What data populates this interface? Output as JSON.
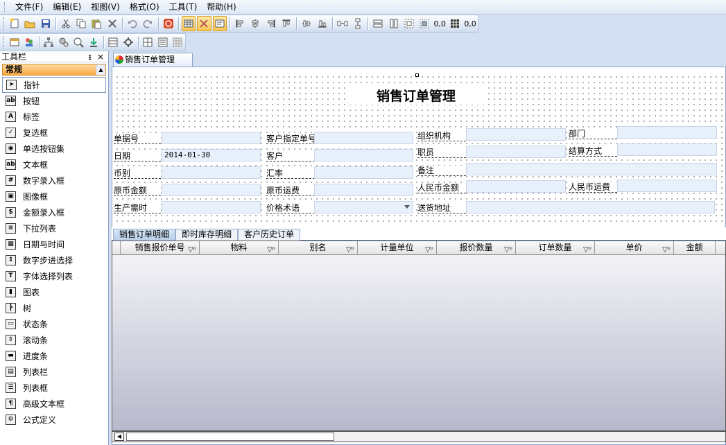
{
  "menu": [
    "文件(F)",
    "编辑(E)",
    "视图(V)",
    "格式(O)",
    "工具(T)",
    "帮助(H)"
  ],
  "toolbar": {
    "spacing_value_1": "0,0",
    "spacing_value_2": "0,0"
  },
  "toolbox": {
    "title": "工具栏",
    "pin": "ᵻ",
    "close": "×",
    "category": "常规",
    "items": [
      {
        "label": "指针",
        "icon": "pointer-icon",
        "glyph": "➤"
      },
      {
        "label": "按钮",
        "icon": "button-icon",
        "glyph": "ab"
      },
      {
        "label": "标签",
        "icon": "label-icon",
        "glyph": "A"
      },
      {
        "label": "复选框",
        "icon": "checkbox-icon",
        "glyph": "✓"
      },
      {
        "label": "单选按钮集",
        "icon": "radio-icon",
        "glyph": "◉"
      },
      {
        "label": "文本框",
        "icon": "textbox-icon",
        "glyph": "ab"
      },
      {
        "label": "数字录入框",
        "icon": "number-input-icon",
        "glyph": "#"
      },
      {
        "label": "图像框",
        "icon": "image-icon",
        "glyph": "▣"
      },
      {
        "label": "金额录入框",
        "icon": "currency-input-icon",
        "glyph": "$"
      },
      {
        "label": "下拉列表",
        "icon": "dropdown-icon",
        "glyph": "≡"
      },
      {
        "label": "日期与时间",
        "icon": "calendar-icon",
        "glyph": "▦"
      },
      {
        "label": "数字步进选择",
        "icon": "stepper-icon",
        "glyph": "⇕"
      },
      {
        "label": "字体选择列表",
        "icon": "font-icon",
        "glyph": "T"
      },
      {
        "label": "图表",
        "icon": "chart-icon",
        "glyph": "▮"
      },
      {
        "label": "树",
        "icon": "tree-icon",
        "glyph": "┣"
      },
      {
        "label": "状态条",
        "icon": "statusbar-icon",
        "glyph": "▭"
      },
      {
        "label": "滚动条",
        "icon": "scrollbar-icon",
        "glyph": "⇳"
      },
      {
        "label": "进度条",
        "icon": "progressbar-icon",
        "glyph": "▬"
      },
      {
        "label": "列表栏",
        "icon": "listbar-icon",
        "glyph": "▤"
      },
      {
        "label": "列表框",
        "icon": "listbox-icon",
        "glyph": "☰"
      },
      {
        "label": "高级文本框",
        "icon": "richtext-icon",
        "glyph": "¶"
      },
      {
        "label": "公式定义",
        "icon": "formula-icon",
        "glyph": "⚙"
      }
    ]
  },
  "document": {
    "tab": "销售订单管理",
    "form_title": "销售订单管理",
    "fields": {
      "bill_no": {
        "label": "单据号",
        "value": ""
      },
      "cust_order_no": {
        "label": "客户指定单号",
        "value": ""
      },
      "org": {
        "label": "组织机构",
        "value": ""
      },
      "dept": {
        "label": "部门",
        "value": ""
      },
      "date": {
        "label": "日期",
        "value": "2014-01-30"
      },
      "customer": {
        "label": "客户",
        "value": ""
      },
      "staff": {
        "label": "职员",
        "value": ""
      },
      "settle": {
        "label": "结算方式",
        "value": ""
      },
      "currency": {
        "label": "币别",
        "value": ""
      },
      "rate": {
        "label": "汇率",
        "value": ""
      },
      "remark": {
        "label": "备注",
        "value": ""
      },
      "orig_amount": {
        "label": "原币金额",
        "value": ""
      },
      "orig_freight": {
        "label": "原币运费",
        "value": ""
      },
      "rmb_amount": {
        "label": "人民币金额",
        "value": ""
      },
      "rmb_freight": {
        "label": "人民币运费",
        "value": ""
      },
      "prod_time": {
        "label": "生产需时",
        "value": ""
      },
      "price_term": {
        "label": "价格术语",
        "value": ""
      },
      "ship_addr": {
        "label": "送货地址",
        "value": ""
      }
    },
    "subtabs": [
      "销售订单明细",
      "即时库存明细",
      "客户历史订单"
    ],
    "grid_columns": [
      "销售报价单号",
      "物料",
      "别名",
      "计量单位",
      "报价数量",
      "订单数量",
      "单价",
      "金额"
    ]
  },
  "colors": {
    "accent_orange": "#f7a844",
    "form_bg": "#d4e0f2",
    "input_bg": "#e8f0fb"
  }
}
